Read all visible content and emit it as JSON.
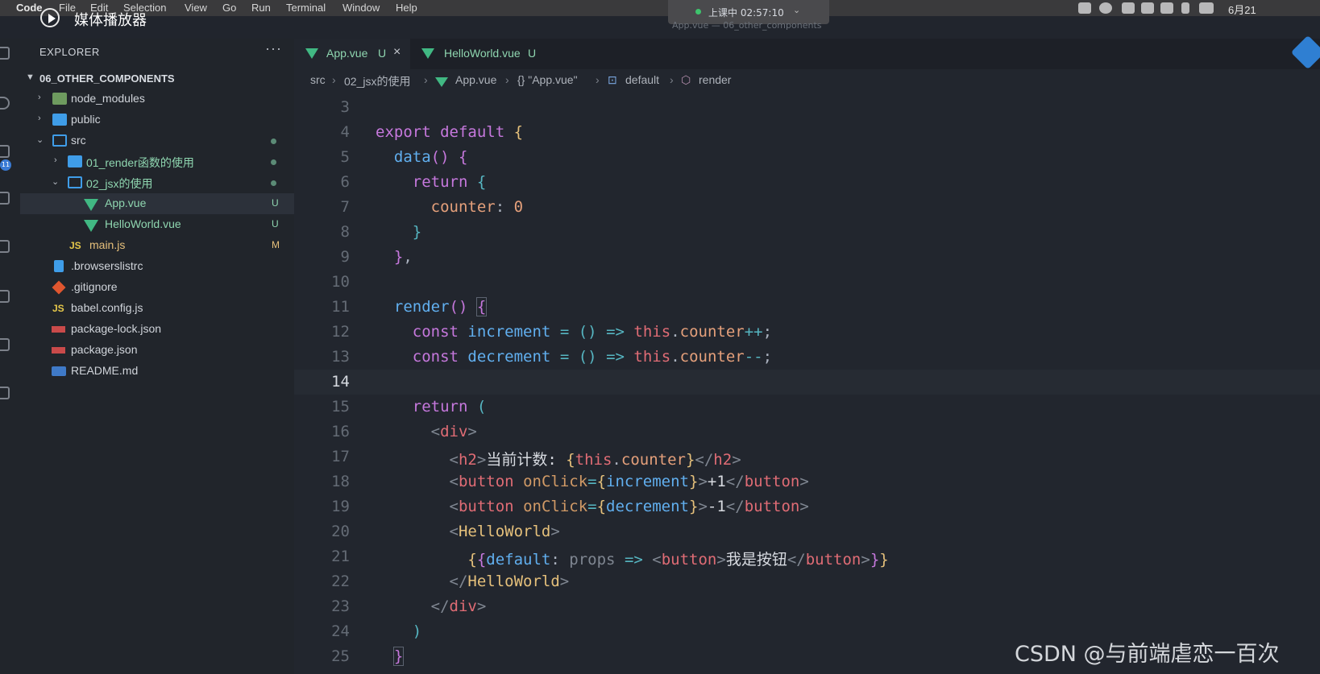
{
  "menubar": {
    "app_name": "Code",
    "items": [
      "File",
      "Edit",
      "Selection",
      "View",
      "Go",
      "Run",
      "Terminal",
      "Window",
      "Help"
    ],
    "class_status": "上课中 02:57:10",
    "date": "6月21"
  },
  "media_player": {
    "label": "媒体播放器"
  },
  "window_title": "App.vue — 06_other_components",
  "activity_bar": {
    "badge": "11"
  },
  "explorer": {
    "header": "EXPLORER",
    "more": "···",
    "project": "06_OTHER_COMPONENTS",
    "items": [
      {
        "label": "node_modules",
        "type": "folder-special",
        "status": ""
      },
      {
        "label": "public",
        "type": "folder",
        "status": ""
      },
      {
        "label": "src",
        "type": "folder-open",
        "status": ""
      },
      {
        "label": "01_render函数的使用",
        "type": "folder",
        "status": ""
      },
      {
        "label": "02_jsx的使用",
        "type": "folder-open",
        "status": ""
      },
      {
        "label": "App.vue",
        "type": "vue",
        "status": "U"
      },
      {
        "label": "HelloWorld.vue",
        "type": "vue",
        "status": "U"
      },
      {
        "label": "main.js",
        "type": "js",
        "status": "M",
        "icon_text": "JS"
      },
      {
        "label": ".browserslistrc",
        "type": "file",
        "status": ""
      },
      {
        "label": ".gitignore",
        "type": "git",
        "status": ""
      },
      {
        "label": "babel.config.js",
        "type": "js",
        "status": "",
        "icon_text": "JS"
      },
      {
        "label": "package-lock.json",
        "type": "npm",
        "status": ""
      },
      {
        "label": "package.json",
        "type": "npm",
        "status": ""
      },
      {
        "label": "README.md",
        "type": "md",
        "status": ""
      }
    ]
  },
  "tabs": [
    {
      "label": "App.vue",
      "status": "U",
      "close": "×"
    },
    {
      "label": "HelloWorld.vue",
      "status": "U"
    }
  ],
  "breadcrumb": [
    "src",
    "02_jsx的使用",
    "App.vue",
    "{} \"App.vue\"",
    "default",
    "render"
  ],
  "code": {
    "current_line": 14,
    "lines": [
      {
        "n": "3"
      },
      {
        "n": "4"
      },
      {
        "n": "5"
      },
      {
        "n": "6"
      },
      {
        "n": "7"
      },
      {
        "n": "8"
      },
      {
        "n": "9"
      },
      {
        "n": "10"
      },
      {
        "n": "11"
      },
      {
        "n": "12"
      },
      {
        "n": "13"
      },
      {
        "n": "14"
      },
      {
        "n": "15"
      },
      {
        "n": "16"
      },
      {
        "n": "17"
      },
      {
        "n": "18"
      },
      {
        "n": "19"
      },
      {
        "n": "20"
      },
      {
        "n": "21"
      },
      {
        "n": "22"
      },
      {
        "n": "23"
      },
      {
        "n": "24"
      },
      {
        "n": "25"
      }
    ],
    "tokens": {
      "export": "export",
      "default": "default",
      "data": "data",
      "return": "return",
      "counter": "counter",
      "zero": "0",
      "render": "render",
      "const": "const",
      "increment": "increment",
      "decrement": "decrement",
      "this": "this",
      "inc_op": "++",
      "dec_op": "--",
      "div": "div",
      "h2": "h2",
      "h2_text": "当前计数: ",
      "button": "button",
      "onClick": "onClick",
      "plus_one": "+1",
      "minus_one": "-1",
      "HelloWorld": "HelloWorld",
      "props": "props",
      "btn_text": "我是按钮"
    }
  },
  "watermark": "CSDN @与前端虐恋一百次"
}
